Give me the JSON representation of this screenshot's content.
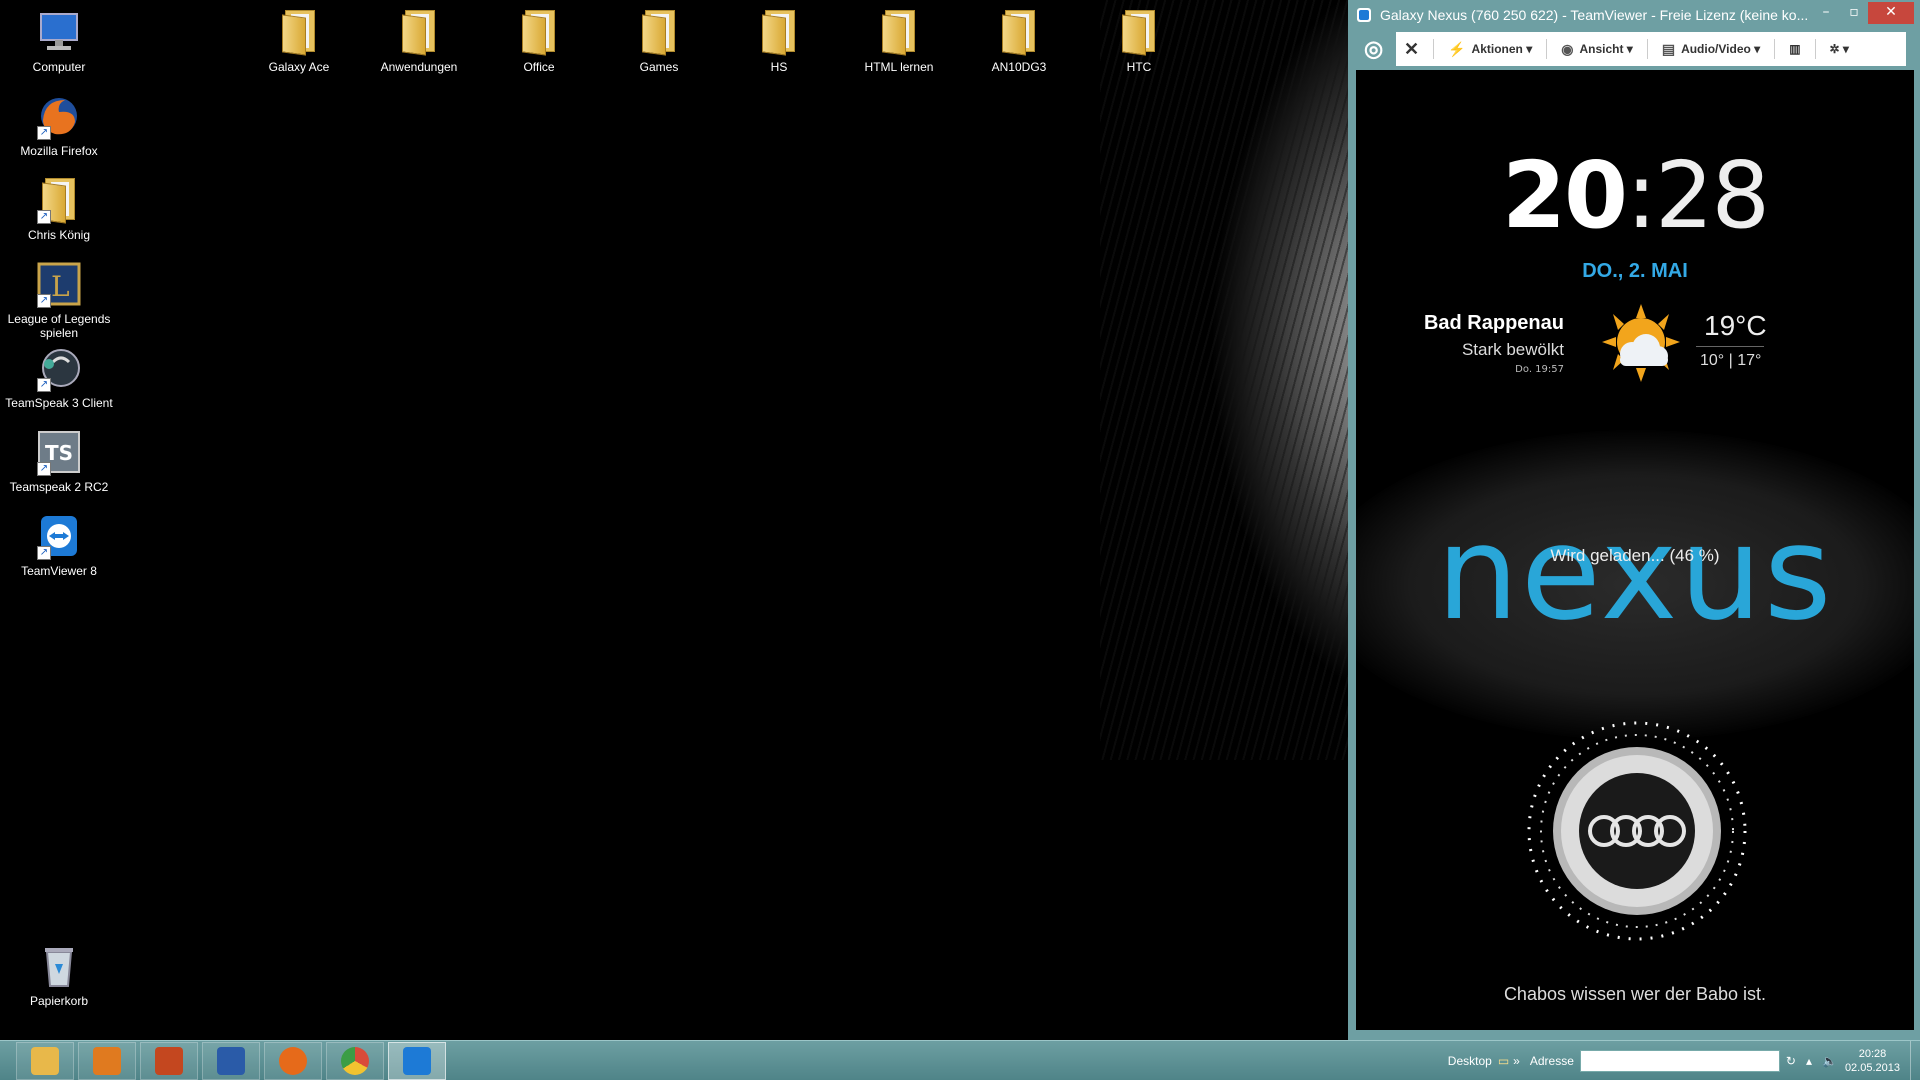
{
  "desktop": {
    "left_icons": [
      {
        "label": "Computer",
        "icon": "computer-icon"
      },
      {
        "label": "Mozilla Firefox",
        "icon": "firefox-icon"
      },
      {
        "label": "Chris König",
        "icon": "user-folder-icon"
      },
      {
        "label": "League of Legends spielen",
        "icon": "league-of-legends-icon"
      },
      {
        "label": "TeamSpeak 3 Client",
        "icon": "teamspeak3-icon"
      },
      {
        "label": "Teamspeak 2 RC2",
        "icon": "teamspeak2-icon"
      },
      {
        "label": "TeamViewer 8",
        "icon": "teamviewer-icon"
      }
    ],
    "recycle_bin": {
      "label": "Papierkorb",
      "icon": "recycle-bin-icon"
    },
    "top_folders": [
      "Galaxy Ace",
      "Anwendungen",
      "Office",
      "Games",
      "HS",
      "HTML lernen",
      "AN10DG3",
      "HTC"
    ]
  },
  "taskbar": {
    "apps": [
      {
        "name": "explorer",
        "icon": "file-explorer-icon",
        "color": "#e8b84a"
      },
      {
        "name": "outlook",
        "icon": "outlook-icon",
        "color": "#e07a1f"
      },
      {
        "name": "powerpoint",
        "icon": "powerpoint-icon",
        "color": "#c4471f"
      },
      {
        "name": "word",
        "icon": "word-icon",
        "color": "#2a5ba8"
      },
      {
        "name": "firefox",
        "icon": "firefox-icon",
        "color": "#e66a1a"
      },
      {
        "name": "chrome",
        "icon": "chrome-icon",
        "color": "#3b9d45"
      },
      {
        "name": "teamviewer",
        "icon": "teamviewer-icon",
        "color": "#1d7ad6"
      }
    ],
    "desktop_label": "Desktop",
    "address_label": "Adresse",
    "address_value": "",
    "time": "20:28",
    "date": "02.05.2013"
  },
  "teamviewer": {
    "title": "Galaxy Nexus (760 250 622) - TeamViewer - Freie Lizenz (keine ko...",
    "toolbar": {
      "actions": "Aktionen",
      "view": "Ansicht",
      "audio_video": "Audio/Video"
    },
    "phone": {
      "clock_hours": "20",
      "clock_sep": ":",
      "clock_minutes": "28",
      "date": "DO., 2. MAI",
      "city": "Bad Rappenau",
      "condition": "Stark bewölkt",
      "updated": "Do. 19:57",
      "temperature": "19°C",
      "low_high": "10° | 17°",
      "brand": "nexus",
      "charging": "Wird geladen... (46 %)",
      "motto": "Chabos wissen wer der Babo ist."
    }
  },
  "colors": {
    "accent_blue": "#29a6d8",
    "taskbar": "#5e9296"
  }
}
